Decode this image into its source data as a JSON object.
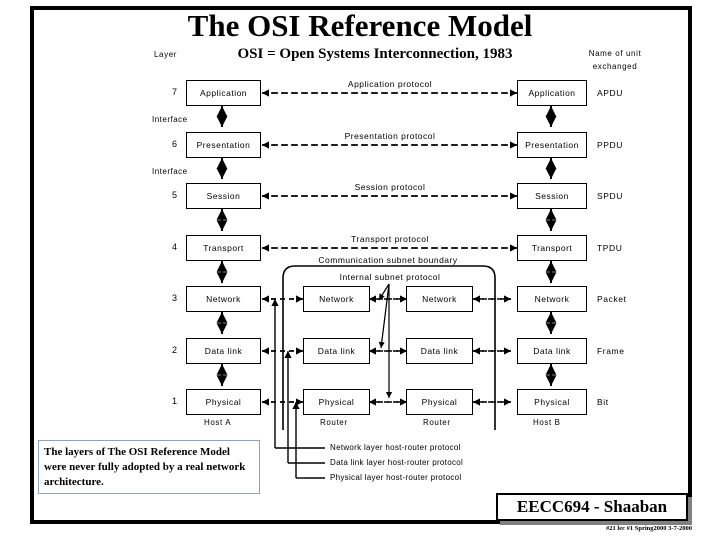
{
  "slide": {
    "title": "The OSI Reference Model",
    "subtitle": "OSI = Open Systems Interconnection, 1983",
    "layer_header": "Layer",
    "unit_header": "Name of unit exchanged"
  },
  "host_a": {
    "label": "Host A",
    "layers": [
      {
        "number": "7",
        "name": "Application"
      },
      {
        "number": "6",
        "name": "Presentation"
      },
      {
        "number": "5",
        "name": "Session"
      },
      {
        "number": "4",
        "name": "Transport"
      },
      {
        "number": "3",
        "name": "Network"
      },
      {
        "number": "2",
        "name": "Data link"
      },
      {
        "number": "1",
        "name": "Physical"
      }
    ],
    "interfaces": [
      {
        "label": "Interface"
      },
      {
        "label": "Interface"
      }
    ]
  },
  "host_b": {
    "label": "Host B",
    "layers": [
      {
        "name": "Application"
      },
      {
        "name": "Presentation"
      },
      {
        "name": "Session"
      },
      {
        "name": "Transport"
      },
      {
        "name": "Network"
      },
      {
        "name": "Data link"
      },
      {
        "name": "Physical"
      }
    ]
  },
  "units": [
    {
      "name": "APDU"
    },
    {
      "name": "PPDU"
    },
    {
      "name": "SPDU"
    },
    {
      "name": "TPDU"
    },
    {
      "name": "Packet"
    },
    {
      "name": "Frame"
    },
    {
      "name": "Bit"
    }
  ],
  "protocols": [
    {
      "name": "Application protocol"
    },
    {
      "name": "Presentation protocol"
    },
    {
      "name": "Session protocol"
    },
    {
      "name": "Transport protocol"
    }
  ],
  "subnet": {
    "boundary_label": "Communication subnet boundary",
    "internal_label": "Internal subnet protocol",
    "router_label_1": "Router",
    "router_label_2": "Router",
    "router1_layers": [
      {
        "name": "Network"
      },
      {
        "name": "Data link"
      },
      {
        "name": "Physical"
      }
    ],
    "router2_layers": [
      {
        "name": "Network"
      },
      {
        "name": "Data link"
      },
      {
        "name": "Physical"
      }
    ]
  },
  "bottom_legend": [
    {
      "label": "Network layer host-router protocol"
    },
    {
      "label": "Data link layer host-router protocol"
    },
    {
      "label": "Physical layer host-router protocol"
    }
  ],
  "note": {
    "text": "The layers of The OSI Reference Model were never fully adopted  by a real network architecture."
  },
  "footer": {
    "course": "EECC694 - Shaaban",
    "meta": "#21 lec #1    Spring2000   3-7-2000"
  }
}
